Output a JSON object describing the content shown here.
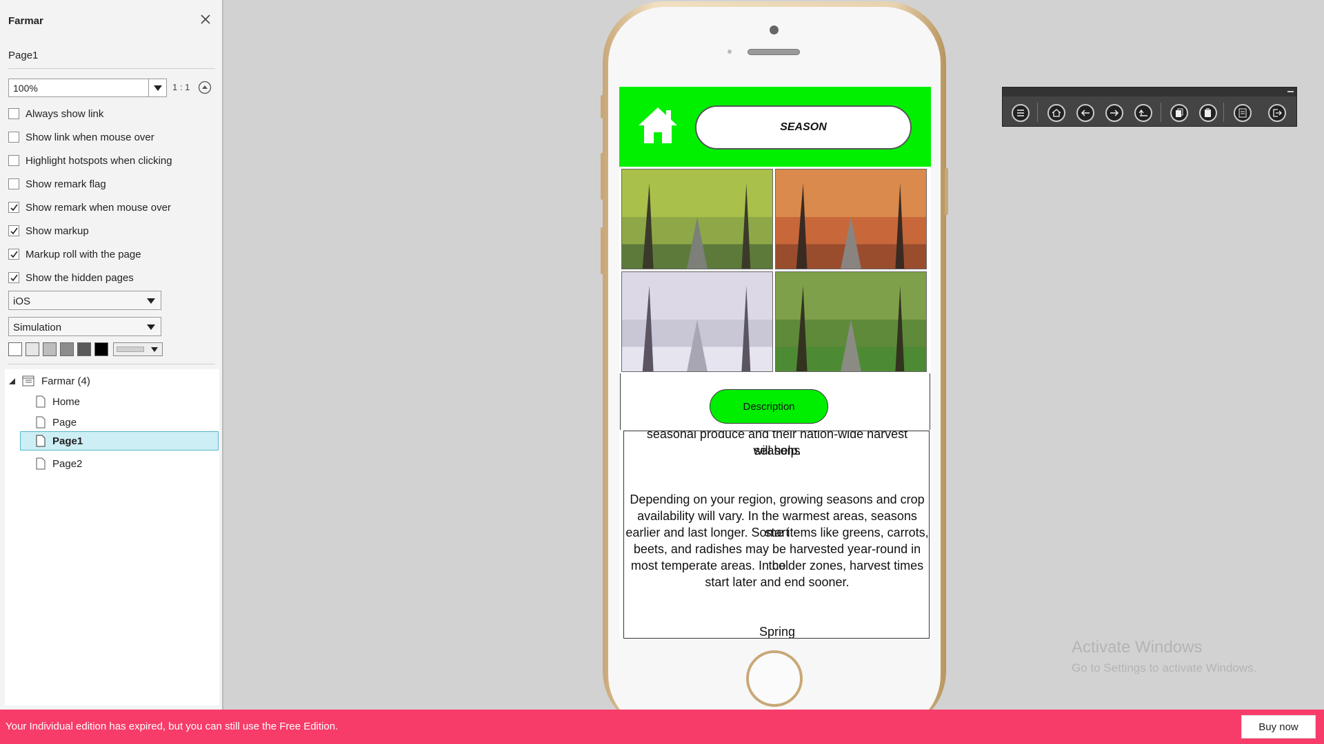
{
  "panel": {
    "title": "Farmar",
    "page_name": "Page1",
    "zoom_value": "100%",
    "ratio_label": "1 : 1",
    "options": [
      {
        "label": "Always show link",
        "checked": false
      },
      {
        "label": "Show link when mouse over",
        "checked": false
      },
      {
        "label": "Highlight hotspots when clicking",
        "checked": false
      },
      {
        "label": "Show remark flag",
        "checked": false
      },
      {
        "label": "Show remark when mouse over",
        "checked": true
      },
      {
        "label": "Show markup",
        "checked": true
      },
      {
        "label": "Markup roll with the page",
        "checked": true
      },
      {
        "label": "Show the hidden pages",
        "checked": true
      }
    ],
    "platform_select": "iOS",
    "mode_select": "Simulation",
    "swatch_colors": [
      "#ffffff",
      "#e6e6e6",
      "#bdbdbd",
      "#8c8c8c",
      "#595959",
      "#000000"
    ],
    "tree": {
      "root": "Farmar (4)",
      "pages": [
        "Home",
        "Page",
        "Page1",
        "Page2"
      ],
      "selected": "Page1"
    }
  },
  "phone": {
    "header_color": "#00f000",
    "season_label": "SEASON",
    "description_label": "Description",
    "text_partial_top": "seasonal produce and their nation-wide harvest seasons",
    "text_line_help": "will help.",
    "paragraph": [
      "Depending on your region, growing seasons and crop",
      "availability will vary. In the warmest areas, seasons start",
      "earlier and last longer. Some items like greens, carrots,",
      "beets, and radishes may be harvested year-round in the",
      "most temperate areas. In colder zones, harvest times",
      "start later and end sooner."
    ],
    "subheading": "Spring",
    "images": [
      "summer-trees",
      "autumn-trees",
      "winter-trees",
      "spring-trees"
    ]
  },
  "toolbar": {
    "buttons": [
      "menu-icon",
      "home-icon",
      "back-arrow-icon",
      "forward-arrow-icon",
      "return-icon",
      "copy-page-icon",
      "paste-page-icon",
      "notes-icon",
      "exit-icon"
    ]
  },
  "watermark": {
    "line1": "Activate Windows",
    "line2": "Go to Settings to activate Windows."
  },
  "banner": {
    "message": "Your Individual edition has expired, but you can still use the Free Edition.",
    "buy_label": "Buy now",
    "color": "#f73c69"
  }
}
